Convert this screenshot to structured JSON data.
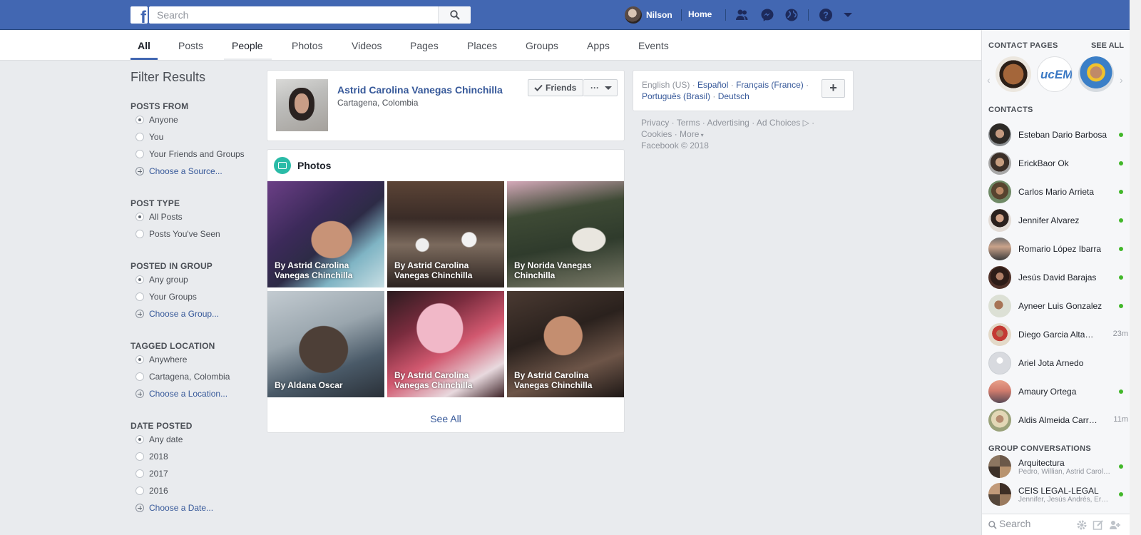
{
  "topbar": {
    "search_placeholder": "Search",
    "user_name": "Nilson",
    "home_label": "Home"
  },
  "tabs": [
    {
      "label": "All",
      "active": true
    },
    {
      "label": "Posts"
    },
    {
      "label": "People"
    },
    {
      "label": "Photos"
    },
    {
      "label": "Videos"
    },
    {
      "label": "Pages"
    },
    {
      "label": "Places"
    },
    {
      "label": "Groups"
    },
    {
      "label": "Apps"
    },
    {
      "label": "Events"
    }
  ],
  "filter": {
    "title": "Filter Results",
    "posts_from": {
      "title": "POSTS FROM",
      "options": [
        "Anyone",
        "You",
        "Your Friends and Groups"
      ],
      "selected": "Anyone",
      "choose": "Choose a Source..."
    },
    "post_type": {
      "title": "POST TYPE",
      "options": [
        "All Posts",
        "Posts You've Seen"
      ],
      "selected": "All Posts"
    },
    "posted_in_group": {
      "title": "POSTED IN GROUP",
      "options": [
        "Any group",
        "Your Groups"
      ],
      "selected": "Any group",
      "choose": "Choose a Group..."
    },
    "tagged_location": {
      "title": "TAGGED LOCATION",
      "options": [
        "Anywhere",
        "Cartagena, Colombia"
      ],
      "selected": "Anywhere",
      "choose": "Choose a Location..."
    },
    "date_posted": {
      "title": "DATE POSTED",
      "options": [
        "Any date",
        "2018",
        "2017",
        "2016"
      ],
      "selected": "Any date",
      "choose": "Choose a Date..."
    }
  },
  "profile": {
    "name": "Astrid Carolina Vanegas Chinchilla",
    "location": "Cartagena, Colombia",
    "friends_label": "Friends",
    "more_label": "···"
  },
  "photos": {
    "title": "Photos",
    "items": [
      {
        "caption": "By Astrid Carolina Vanegas Chinchilla"
      },
      {
        "caption": "By Astrid Carolina Vanegas Chinchilla"
      },
      {
        "caption": "By Norida Vanegas Chinchilla"
      },
      {
        "caption": "By Aldana Oscar"
      },
      {
        "caption": "By Astrid Carolina Vanegas Chinchilla"
      },
      {
        "caption": "By Astrid Carolina Vanegas Chinchilla"
      }
    ],
    "see_all": "See All"
  },
  "languages": {
    "current": "English (US)",
    "links": [
      "Español",
      "Français (France)",
      "Português (Brasil)",
      "Deutsch"
    ],
    "add_label": "+"
  },
  "footer": {
    "links": [
      "Privacy",
      "Terms",
      "Advertising",
      "Ad Choices",
      "Cookies",
      "More"
    ],
    "copyright": "Facebook © 2018"
  },
  "sidebar": {
    "contact_pages_title": "CONTACT PAGES",
    "see_all": "SEE ALL",
    "contacts_title": "CONTACTS",
    "contacts": [
      {
        "name": "Esteban Dario Barbosa",
        "online": true
      },
      {
        "name": "ErickBaor Ok",
        "online": true
      },
      {
        "name": "Carlos Mario Arrieta",
        "online": true
      },
      {
        "name": "Jennifer Alvarez",
        "online": true
      },
      {
        "name": "Romario López Ibarra",
        "online": true
      },
      {
        "name": "Jesús David Barajas",
        "online": true
      },
      {
        "name": "Ayneer Luis Gonzalez",
        "online": true
      },
      {
        "name": "Diego Garcia Altamar",
        "time": "23m"
      },
      {
        "name": "Ariel Jota Arnedo"
      },
      {
        "name": "Amaury Ortega",
        "online": true
      },
      {
        "name": "Aldis Almeida Carrasquilla",
        "time": "11m"
      }
    ],
    "group_title": "GROUP CONVERSATIONS",
    "groups": [
      {
        "name": "Arquitectura",
        "members": "Pedro, Willian, Astrid Carolina",
        "online": true
      },
      {
        "name": "CEIS LEGAL-LEGAL",
        "members": "Jennifer, Jesús Andrés, Ernesto",
        "online": true
      }
    ],
    "search_placeholder": "Search"
  },
  "colors": {
    "brand": "#4267b2",
    "link": "#365899",
    "online": "#42b72a",
    "photos_icon": "#2abba7"
  }
}
